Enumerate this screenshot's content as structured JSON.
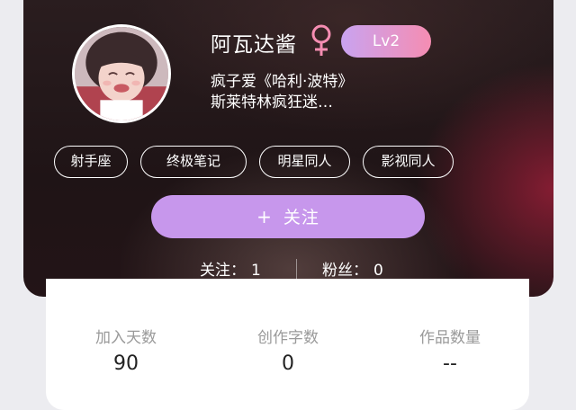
{
  "profile": {
    "username": "阿瓦达酱",
    "gender_icon": "female-icon",
    "level": "Lv2",
    "bio_line1": "疯子爱《哈利·波特》",
    "bio_line2": "斯莱特林疯狂迷…",
    "tags": [
      "射手座",
      "终极笔记",
      "明星同人",
      "影视同人"
    ],
    "follow_button": {
      "icon": "plus-icon",
      "icon_glyph": "+",
      "label": "关注"
    },
    "following": {
      "label": "关注：",
      "value": "1"
    },
    "fans": {
      "label": "粉丝：",
      "value": "0"
    }
  },
  "stats": [
    {
      "label": "加入天数",
      "value": "90"
    },
    {
      "label": "创作字数",
      "value": "0"
    },
    {
      "label": "作品数量",
      "value": "--"
    }
  ],
  "colors": {
    "accent_top": "#2bb6f0",
    "follow_button": "#c797ec",
    "level_badge_start": "#c9a3f0",
    "level_badge_end": "#f58db2"
  }
}
